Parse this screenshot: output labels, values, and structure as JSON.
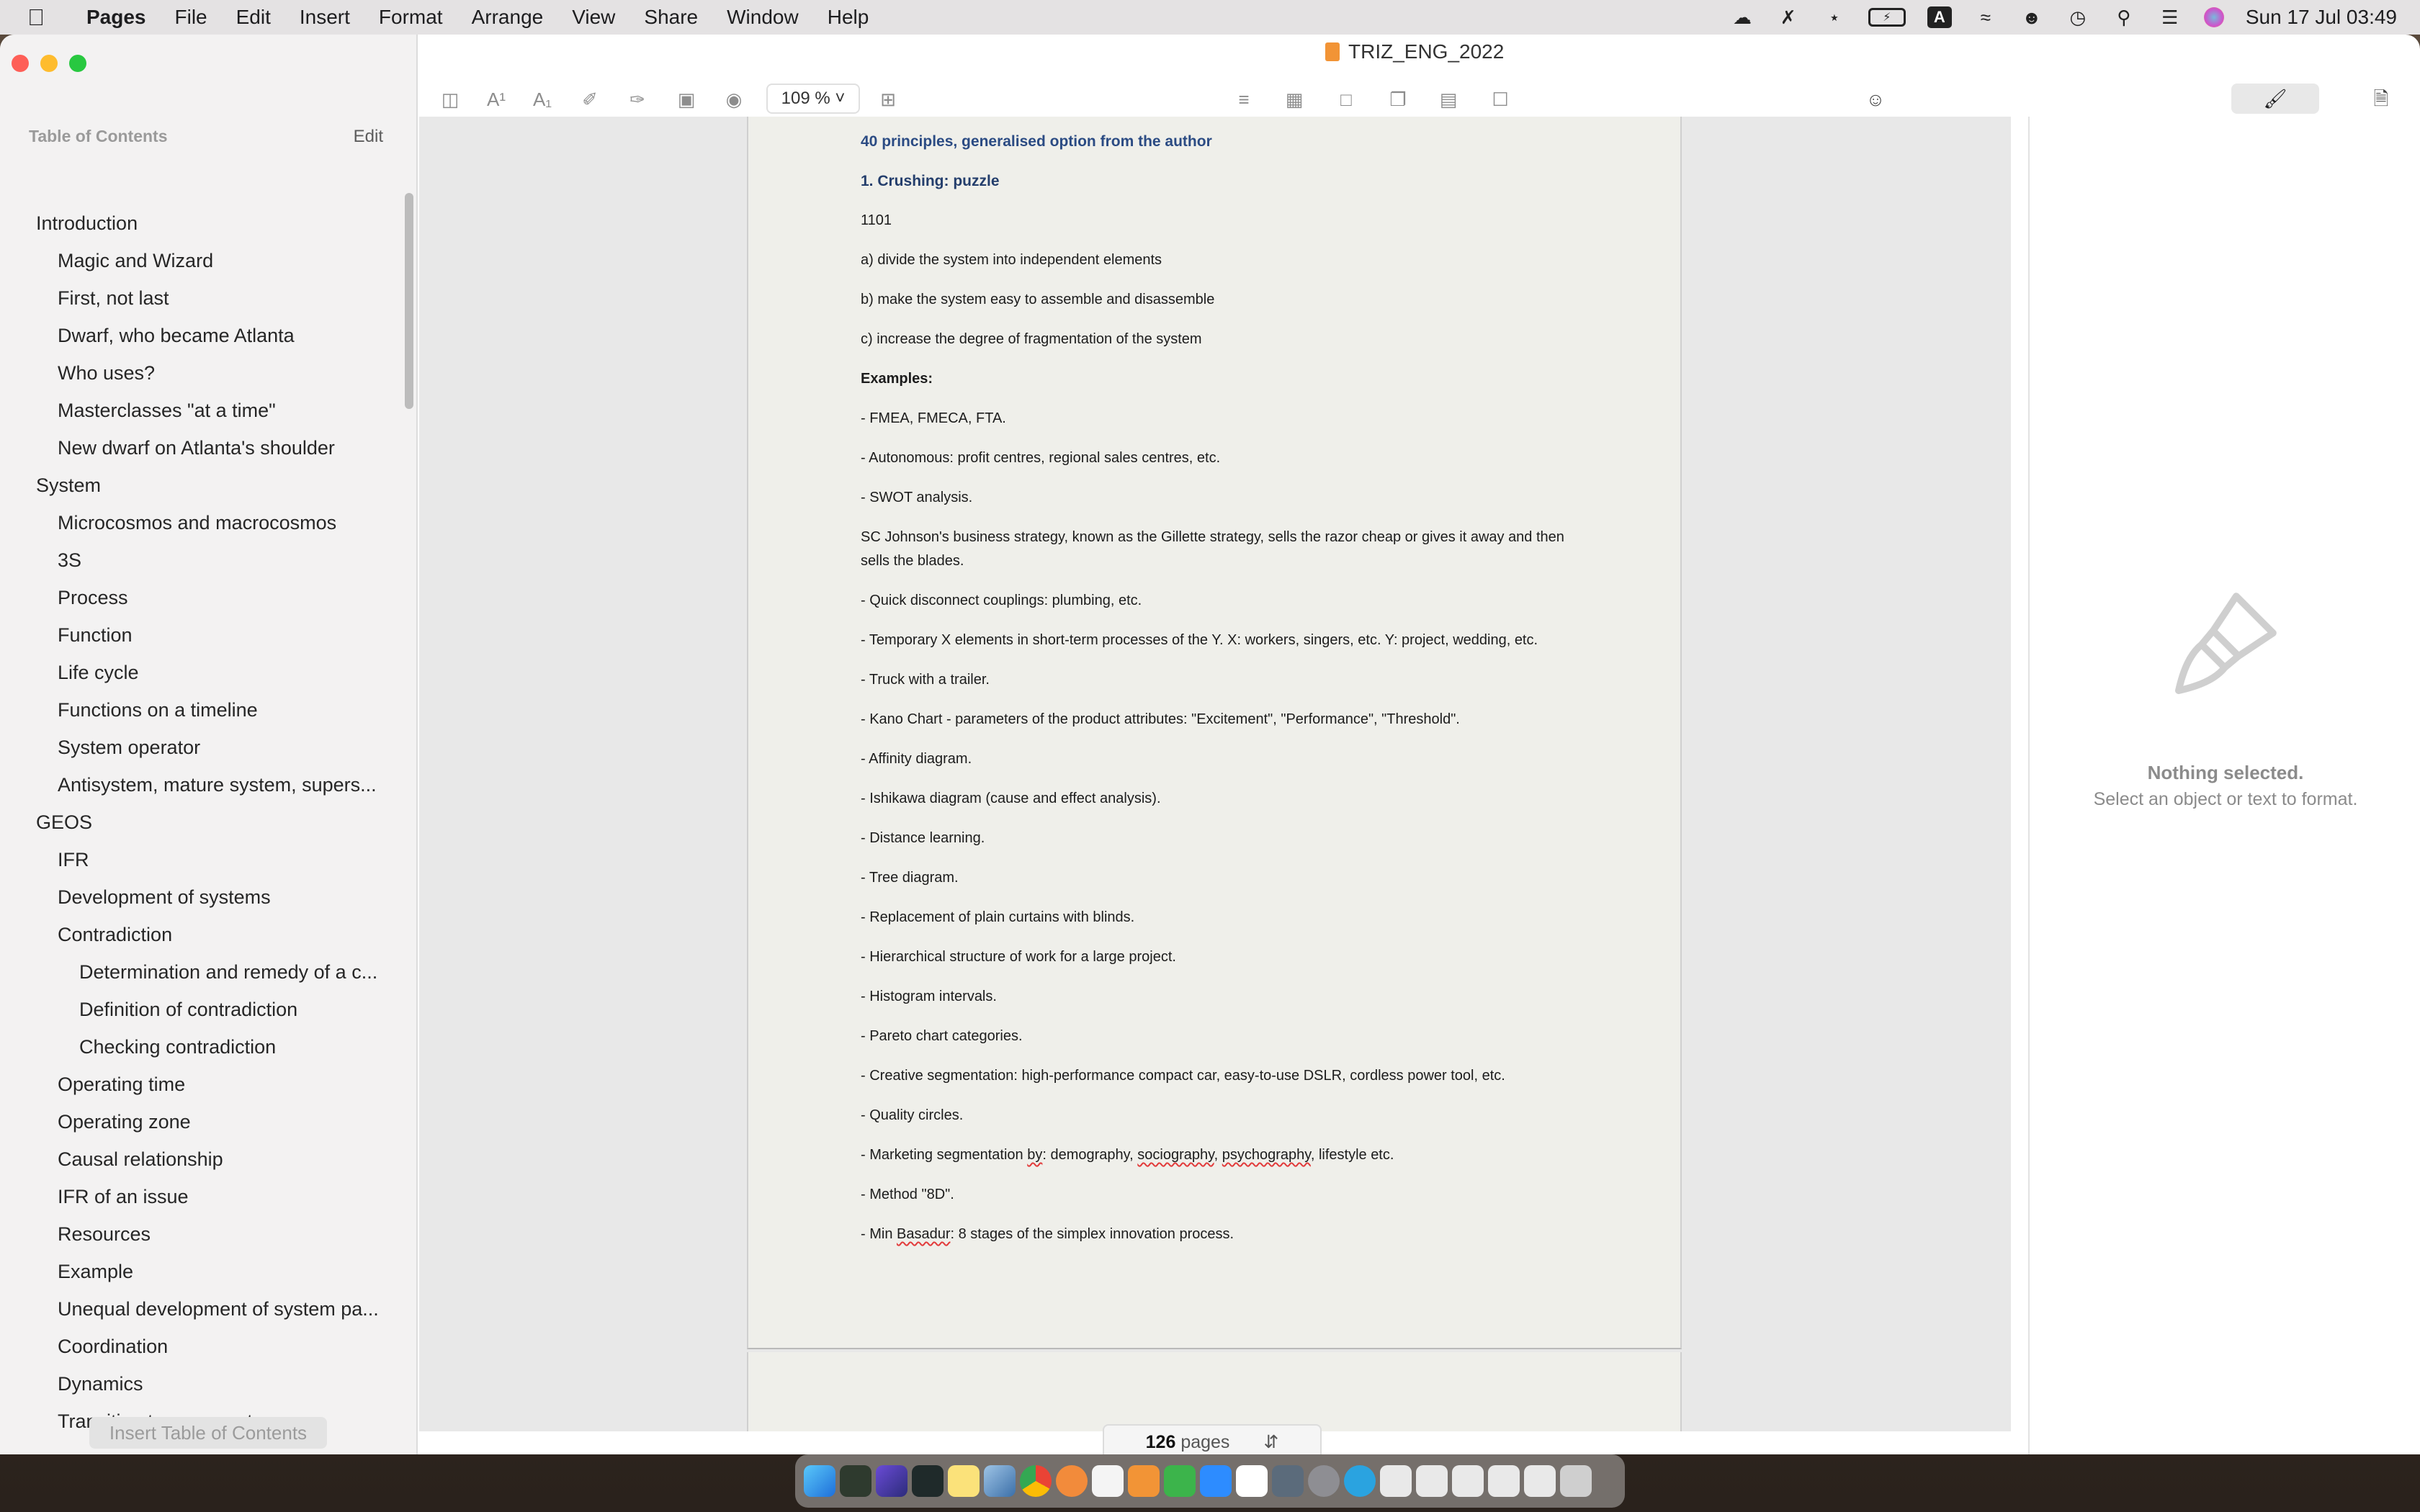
{
  "menubar": {
    "app_name": "Pages",
    "items": [
      "File",
      "Edit",
      "Insert",
      "Format",
      "Arrange",
      "View",
      "Share",
      "Window",
      "Help"
    ],
    "datetime": "Sun 17 Jul  03:49",
    "status_icons": [
      "creative-cloud-icon",
      "mute-icon",
      "bluetooth-icon",
      "battery-icon",
      "input-source-icon",
      "wifi-icon",
      "user-icon",
      "time-machine-icon",
      "spotlight-icon",
      "control-center-icon",
      "siri-icon"
    ],
    "input_letter": "A"
  },
  "window": {
    "title": "TRIZ_ENG_2022"
  },
  "toolbar": {
    "zoom": "109 %",
    "icons": [
      "sidebar-icon",
      "superscript-icon",
      "subscript-icon",
      "highlight-icon",
      "color-icon",
      "bookmark-icon",
      "focus-icon",
      "add-page-icon",
      "text-list-icon",
      "table-icon",
      "text-box-icon",
      "shape-icon",
      "media-icon",
      "comment-icon",
      "collaborate-icon",
      "format-brush-icon",
      "document-icon"
    ]
  },
  "sidebar": {
    "header": "Table of Contents",
    "edit_label": "Edit",
    "insert_label": "Insert Table of Contents",
    "items": [
      {
        "label": "Introduction",
        "level": 0
      },
      {
        "label": "Magic and Wizard",
        "level": 1
      },
      {
        "label": "First, not last",
        "level": 1
      },
      {
        "label": "Dwarf, who became Atlanta",
        "level": 1
      },
      {
        "label": "Who uses?",
        "level": 1
      },
      {
        "label": "Masterclasses \"at a time\"",
        "level": 1
      },
      {
        "label": "New dwarf on Atlanta's shoulder",
        "level": 1
      },
      {
        "label": "System",
        "level": 0
      },
      {
        "label": "Microcosmos and macrocosmos",
        "level": 1
      },
      {
        "label": "3S",
        "level": 1
      },
      {
        "label": "Process",
        "level": 1
      },
      {
        "label": "Function",
        "level": 1
      },
      {
        "label": "Life cycle",
        "level": 1
      },
      {
        "label": "Functions on a timeline",
        "level": 1
      },
      {
        "label": "System operator",
        "level": 1
      },
      {
        "label": "Antisystem, mature system, supers...",
        "level": 1
      },
      {
        "label": "GEOS",
        "level": 0
      },
      {
        "label": "IFR",
        "level": 1
      },
      {
        "label": "Development of systems",
        "level": 1
      },
      {
        "label": "Contradiction",
        "level": 1
      },
      {
        "label": "Determination and remedy of a c...",
        "level": 2
      },
      {
        "label": "Definition of contradiction",
        "level": 2
      },
      {
        "label": "Checking contradiction",
        "level": 2
      },
      {
        "label": "Operating time",
        "level": 1
      },
      {
        "label": "Operating zone",
        "level": 1
      },
      {
        "label": "Causal relationship",
        "level": 1
      },
      {
        "label": "IFR of an issue",
        "level": 1
      },
      {
        "label": "Resources",
        "level": 1
      },
      {
        "label": "Example",
        "level": 1
      },
      {
        "label": "Unequal development of system pa...",
        "level": 1
      },
      {
        "label": "Coordination",
        "level": 1
      },
      {
        "label": "Dynamics",
        "level": 1
      },
      {
        "label": "Transition to supersystem",
        "level": 1
      }
    ]
  },
  "document": {
    "heading": "40 principles, generalised option from the author",
    "subheading": "1. Crushing: puzzle",
    "code": "1101",
    "lines_a": [
      "a) divide the system into independent elements",
      "b) make the system easy to assemble and disassemble",
      "c) increase the degree of fragmentation of the system"
    ],
    "examples_label": "Examples:",
    "examples": [
      "- FMEA, FMECA, FTA.",
      "- Autonomous: profit centres, regional sales centres, etc.",
      "- SWOT analysis.",
      "SC Johnson's business strategy, known as the Gillette strategy, sells the razor cheap or gives it away and then sells the blades.",
      "- Quick disconnect couplings: plumbing, etc.",
      "- Temporary X elements in short-term processes of the Y. X: workers, singers, etc. Y: project, wedding, etc.",
      "- Truck with a trailer.",
      "- Kano Chart - parameters of the product attributes: \"Excitement\", \"Performance\", \"Threshold\".",
      "- Affinity diagram.",
      "- Ishikawa diagram (cause and effect analysis).",
      "- Distance learning.",
      "- Tree diagram.",
      "- Replacement of plain curtains with blinds.",
      "- Hierarchical structure of work for a large project.",
      "- Histogram intervals.",
      "- Pareto chart categories.",
      "- Creative segmentation: high-performance compact car, easy-to-use DSLR, cordless power tool, etc.",
      "- Quality circles."
    ],
    "marketing": {
      "prefix": "- Marketing segmentation ",
      "w1": "by",
      "s1": ": demography, ",
      "w2": "sociography",
      "s2": ", ",
      "w3": "psychography",
      "suffix": ", lifestyle etc."
    },
    "method8d": "- Method \"8D\".",
    "basadur": {
      "prefix": "- Min ",
      "word": "Basadur",
      "suffix": ": 8 stages of the simplex innovation process."
    }
  },
  "page_counter": {
    "count": "126",
    "label": "pages"
  },
  "inspector": {
    "title": "Nothing selected.",
    "subtitle": "Select an object or text to format."
  },
  "dock": {
    "apps": [
      "finder-icon",
      "klack-icon",
      "app-icon",
      "terminal-icon",
      "notes-icon",
      "preview-icon",
      "chrome-icon",
      "transmit-icon",
      "textedit-icon",
      "pages-icon",
      "numbers-icon",
      "zoom-icon",
      "ia-writer-icon",
      "screen-icon",
      "system-preferences-icon",
      "telegram-icon",
      "recent-doc-icon",
      "trash-icon"
    ]
  },
  "colors": {
    "heading_blue": "#2b4b83",
    "close": "#fe5f57",
    "minimize": "#febc2e",
    "zoom": "#28c840"
  }
}
